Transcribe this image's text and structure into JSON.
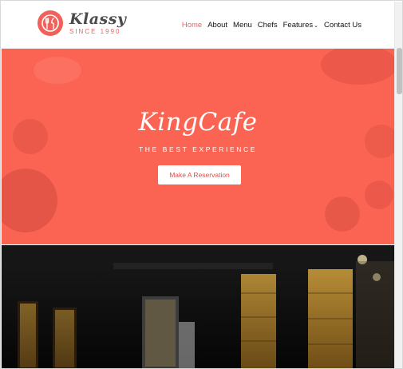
{
  "brand": {
    "name": "Klassy",
    "tagline": "SINCE 1990",
    "accent": "#f0615a"
  },
  "nav": {
    "items": [
      {
        "label": "Home",
        "active": true
      },
      {
        "label": "About",
        "active": false
      },
      {
        "label": "Menu",
        "active": false
      },
      {
        "label": "Chefs",
        "active": false
      },
      {
        "label": "Features",
        "active": false,
        "has_dropdown": true
      },
      {
        "label": "Contact Us",
        "active": false
      }
    ]
  },
  "hero": {
    "title": "KingCafe",
    "subtitle": "THE BEST EXPERIENCE",
    "cta_label": "Make A Reservation",
    "bg_color": "#fb6453"
  },
  "icons": {
    "logo": "fork-plate-icon",
    "dropdown": "chevron-down-icon"
  }
}
